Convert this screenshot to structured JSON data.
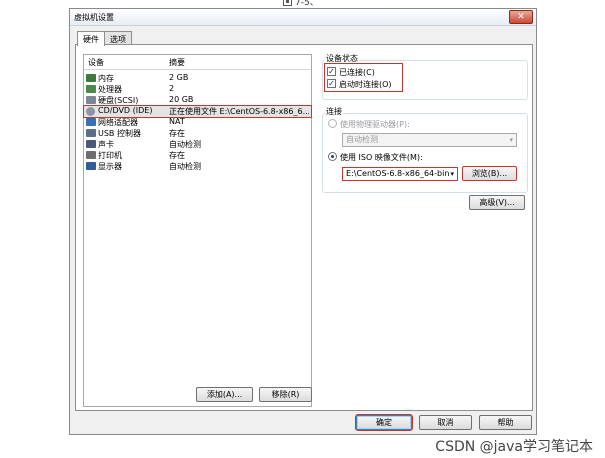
{
  "caption_top": "7-5、",
  "window": {
    "title": "虚拟机设置",
    "close_glyph": "✕"
  },
  "tabs": [
    {
      "label": "硬件",
      "active": true
    },
    {
      "label": "选项",
      "active": false
    }
  ],
  "device_table": {
    "headers": {
      "device": "设备",
      "summary": "摘要"
    },
    "rows": [
      {
        "name": "内存",
        "summary": "2 GB",
        "icon": "memory-icon",
        "color": "#3f7a3a"
      },
      {
        "name": "处理器",
        "summary": "2",
        "icon": "cpu-icon",
        "color": "#4b8a4a"
      },
      {
        "name": "硬盘(SCSI)",
        "summary": "20 GB",
        "icon": "hard-disk-icon",
        "color": "#7b8797"
      },
      {
        "name": "CD/DVD (IDE)",
        "summary": "正在使用文件 E:\\CentOS-6.8-x86_6...",
        "icon": "cd-dvd-icon",
        "color": "#8b96a6",
        "selected": true
      },
      {
        "name": "网络适配器",
        "summary": "NAT",
        "icon": "network-adapter-icon",
        "color": "#3a6fb4"
      },
      {
        "name": "USB 控制器",
        "summary": "存在",
        "icon": "usb-icon",
        "color": "#5d6f86"
      },
      {
        "name": "声卡",
        "summary": "自动检测",
        "icon": "sound-card-icon",
        "color": "#4a5a7a"
      },
      {
        "name": "打印机",
        "summary": "存在",
        "icon": "printer-icon",
        "color": "#6d6d6d"
      },
      {
        "name": "显示器",
        "summary": "自动检测",
        "icon": "monitor-icon",
        "color": "#2f5d9a"
      }
    ]
  },
  "device_buttons": {
    "add": "添加(A)...",
    "remove": "移除(R)"
  },
  "device_status": {
    "title": "设备状态",
    "connected": {
      "label": "已连接(C)",
      "checked": true
    },
    "connect_at_power_on": {
      "label": "启动时连接(O)",
      "checked": true
    }
  },
  "connection": {
    "title": "连接",
    "physical": {
      "label": "使用物理驱动器(P):",
      "selected": false
    },
    "physical_select": "自动检测",
    "iso": {
      "label": "使用 ISO 映像文件(M):",
      "selected": true
    },
    "iso_path": "E:\\CentOS-6.8-x86_64-bin-",
    "browse": "浏览(B)...",
    "advanced": "高级(V)..."
  },
  "footer": {
    "ok": "确定",
    "cancel": "取消",
    "help": "帮助"
  },
  "watermark": "CSDN @java学习笔记本",
  "colors": {
    "highlight_red": "#c5352c",
    "ok_border": "#3c7fb1"
  }
}
